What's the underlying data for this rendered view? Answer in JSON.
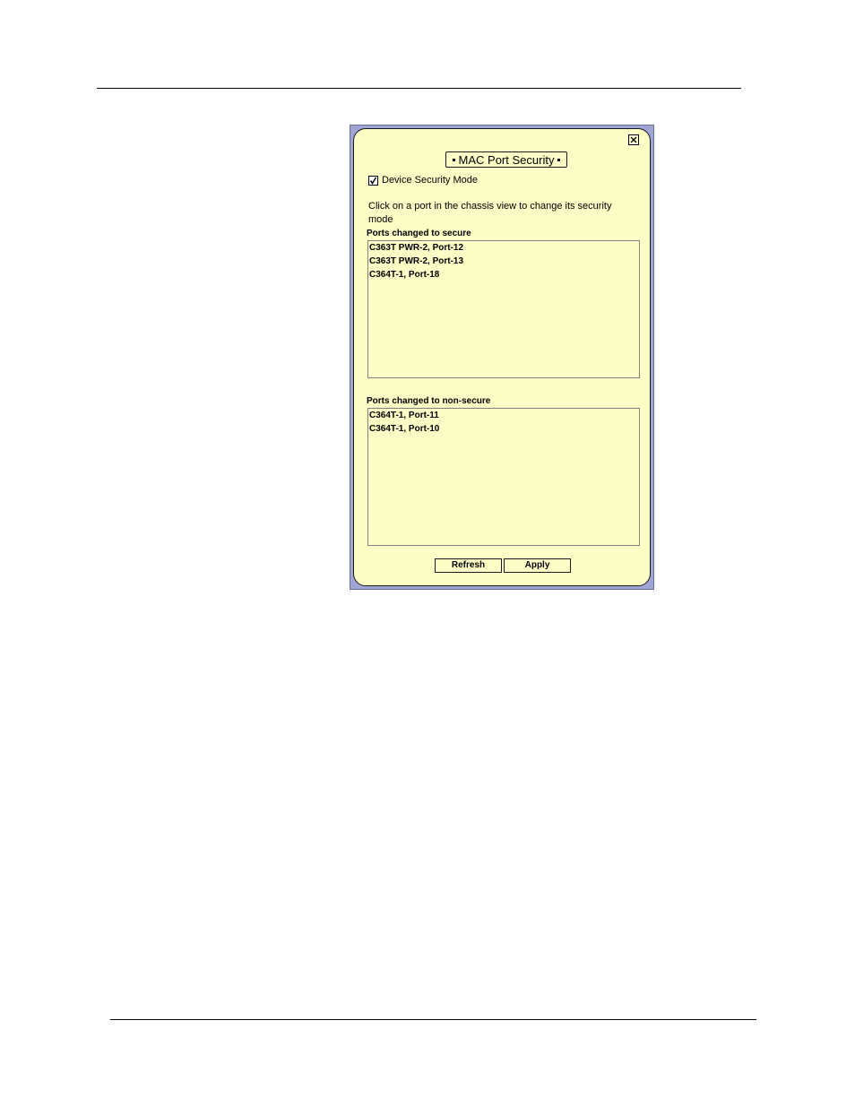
{
  "window": {
    "title": "MAC Port Security",
    "close_icon": "close-icon"
  },
  "device_security_mode": {
    "label": "Device Security Mode",
    "checked": true
  },
  "instruction": "Click on a port in the chassis view to change its security mode",
  "secure_ports": {
    "label": "Ports changed to secure",
    "items": [
      "C363T PWR-2, Port-12",
      "C363T PWR-2, Port-13",
      "C364T-1, Port-18"
    ]
  },
  "nonsecure_ports": {
    "label": "Ports changed to non-secure",
    "items": [
      "C364T-1, Port-11",
      "C364T-1, Port-10"
    ]
  },
  "buttons": {
    "refresh": "Refresh",
    "apply": "Apply"
  },
  "colors": {
    "panel_background": "#fdfdc6",
    "window_frame": "#9fa6d6"
  }
}
